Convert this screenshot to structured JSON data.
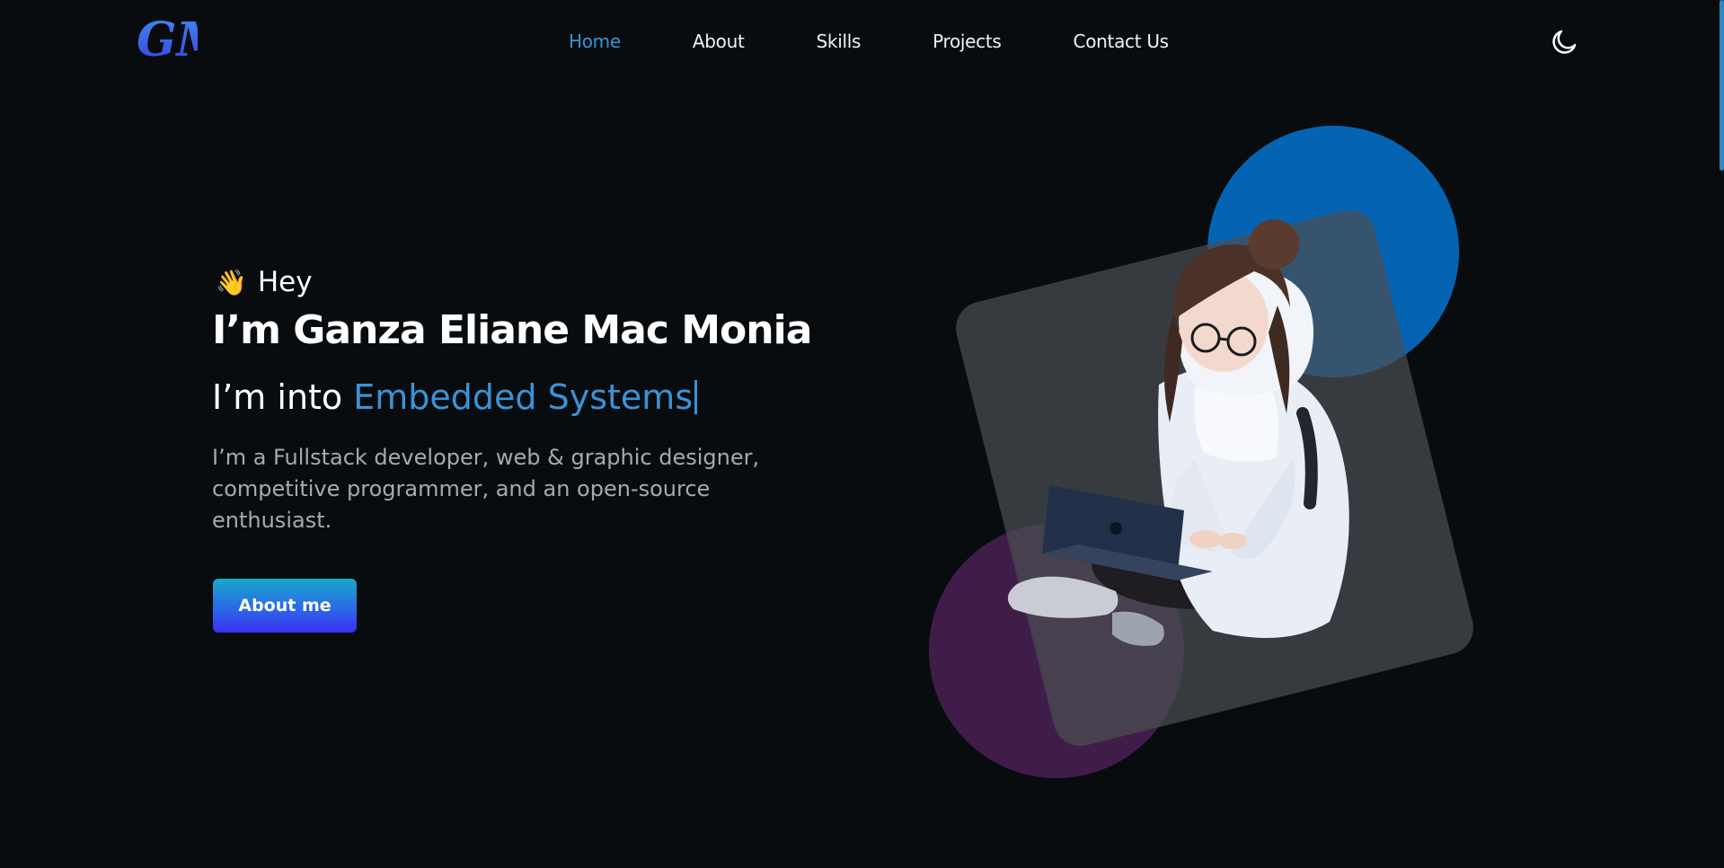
{
  "nav": {
    "logo_text": "GM",
    "items": [
      {
        "label": "Home",
        "active": true
      },
      {
        "label": "About",
        "active": false
      },
      {
        "label": "Skills",
        "active": false
      },
      {
        "label": "Projects",
        "active": false
      },
      {
        "label": "Contact Us",
        "active": false
      }
    ],
    "theme_toggle_icon": "moon-icon"
  },
  "hero": {
    "wave_emoji": "👋",
    "greeting": "Hey",
    "name": "I’m Ganza Eliane Mac Monia",
    "into_prefix": "I’m into ",
    "role": "Embedded Systems",
    "bio": "I’m a Fullstack developer, web & graphic designer, competitive programmer, and an open-source enthusiast.",
    "cta_label": "About me"
  },
  "colors": {
    "background": "#090c0f",
    "accent": "#3a93d6",
    "blue_circle": "#0464b3",
    "purple_circle": "#3f1d48",
    "card": "#3a3d42"
  }
}
